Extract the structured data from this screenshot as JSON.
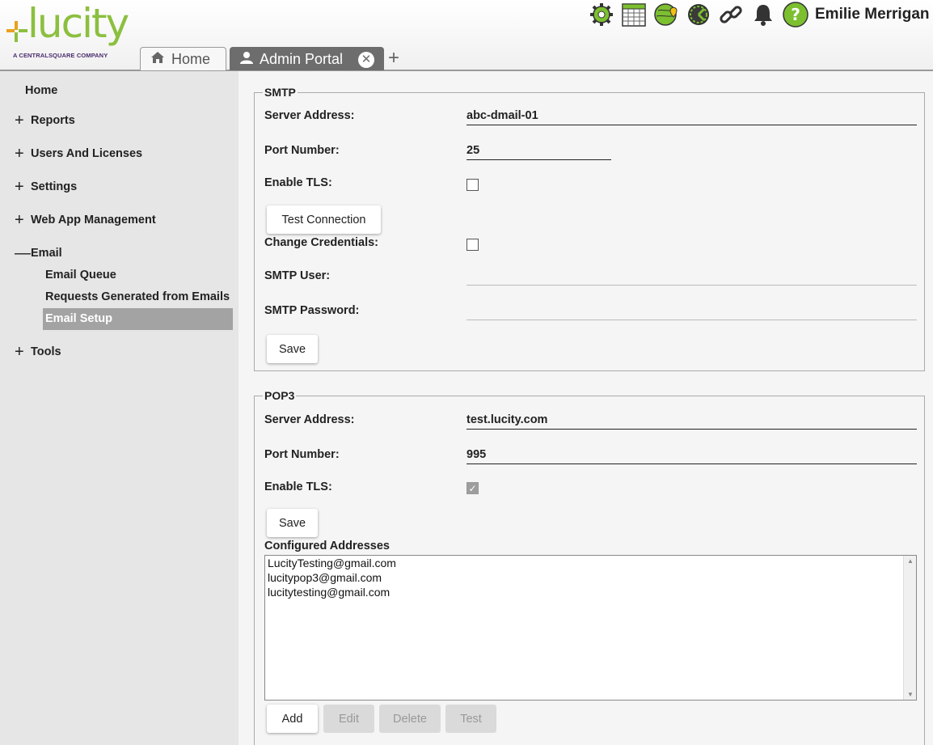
{
  "brand": {
    "name": "lucity",
    "tagline": "A CENTRALSQUARE COMPANY",
    "colors": {
      "green": "#8cbf3f",
      "orange": "#e8a11e",
      "purple": "#4a2c6e"
    }
  },
  "tabs": [
    {
      "label": "Home",
      "icon": "home-icon"
    },
    {
      "label": "Admin Portal",
      "icon": "user-icon",
      "active": true
    }
  ],
  "header": {
    "icons": [
      "gear-icon",
      "calendar-icon",
      "map-marker-icon",
      "dashboard-icon",
      "link-icon",
      "bell-icon",
      "help-icon"
    ],
    "user": "Emilie Merrigan"
  },
  "sidebar": {
    "home": "Home",
    "sections": [
      {
        "label": "Reports",
        "sign": "+"
      },
      {
        "label": "Users And Licenses",
        "sign": "+"
      },
      {
        "label": "Settings",
        "sign": "+"
      },
      {
        "label": "Web App Management",
        "sign": "+"
      },
      {
        "label": "Email",
        "sign": "—"
      },
      {
        "label": "Tools",
        "sign": "+"
      }
    ],
    "email_children": [
      "Email Queue",
      "Requests Generated from Emails",
      "Email Setup"
    ],
    "active": "Email Setup"
  },
  "smtp": {
    "legend": "SMTP",
    "server_label": "Server Address:",
    "server_value": "abc-dmail-01",
    "port_label": "Port Number:",
    "port_value": "25",
    "tls_label": "Enable TLS:",
    "tls_checked": false,
    "test_button": "Test Connection",
    "credentials_label": "Change Credentials:",
    "credentials_checked": false,
    "user_label": "SMTP User:",
    "password_label": "SMTP Password:",
    "save_button": "Save"
  },
  "pop3": {
    "legend": "POP3",
    "server_label": "Server Address:",
    "server_value": "test.lucity.com",
    "port_label": "Port Number:",
    "port_value": "995",
    "tls_label": "Enable TLS:",
    "tls_checked": true,
    "save_button": "Save",
    "addresses_label": "Configured Addresses",
    "addresses": [
      "LucityTesting@gmail.com",
      "lucitypop3@gmail.com",
      "lucitytesting@gmail.com"
    ],
    "add_button": "Add",
    "edit_button": "Edit",
    "delete_button": "Delete",
    "test_button": "Test"
  }
}
